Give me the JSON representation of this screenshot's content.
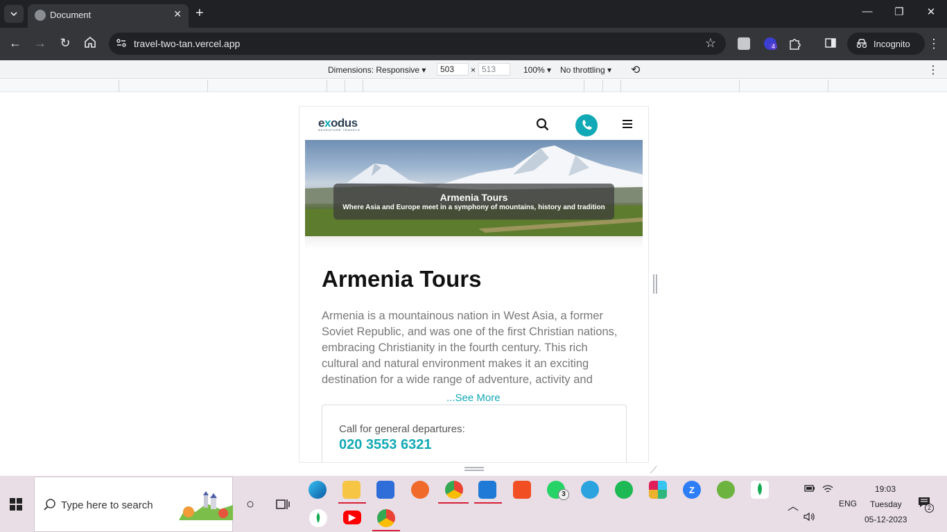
{
  "browser": {
    "tab_title": "Document",
    "url": "travel-two-tan.vercel.app",
    "incognito_label": "Incognito",
    "extension_badge": "4"
  },
  "devtools": {
    "dimensions_label": "Dimensions: Responsive",
    "width": "503",
    "height": "513",
    "times": "×",
    "zoom": "100%",
    "throttling": "No throttling"
  },
  "site": {
    "logo_prefix": "e",
    "logo_x": "x",
    "logo_suffix": "odus",
    "logo_tagline": "ADVENTURE TRAVELS",
    "hero_title": "Armenia Tours",
    "hero_subtitle": "Where Asia and Europe meet in a symphony of mountains, history and tradition",
    "page_title": "Armenia Tours",
    "description": "Armenia is a mountainous nation in West Asia, a former Soviet Republic, and was one of the first Christian nations, embracing Christianity in the fourth century. This rich cultural and natural environment makes it an exciting destination for a wide range of adventure, activity and",
    "see_more": "...See More",
    "call_label": "Call for general departures:",
    "call_number": "020 3553 6321"
  },
  "taskbar": {
    "search_placeholder": "Type here to search",
    "whatsapp_badge": "3",
    "language": "ENG",
    "time": "19:03",
    "day": "Tuesday",
    "date": "05-12-2023",
    "notification_badge": "2"
  },
  "colors": {
    "accent": "#11a9b5",
    "chrome_dark": "#202124",
    "taskbar": "#e9dde6"
  }
}
